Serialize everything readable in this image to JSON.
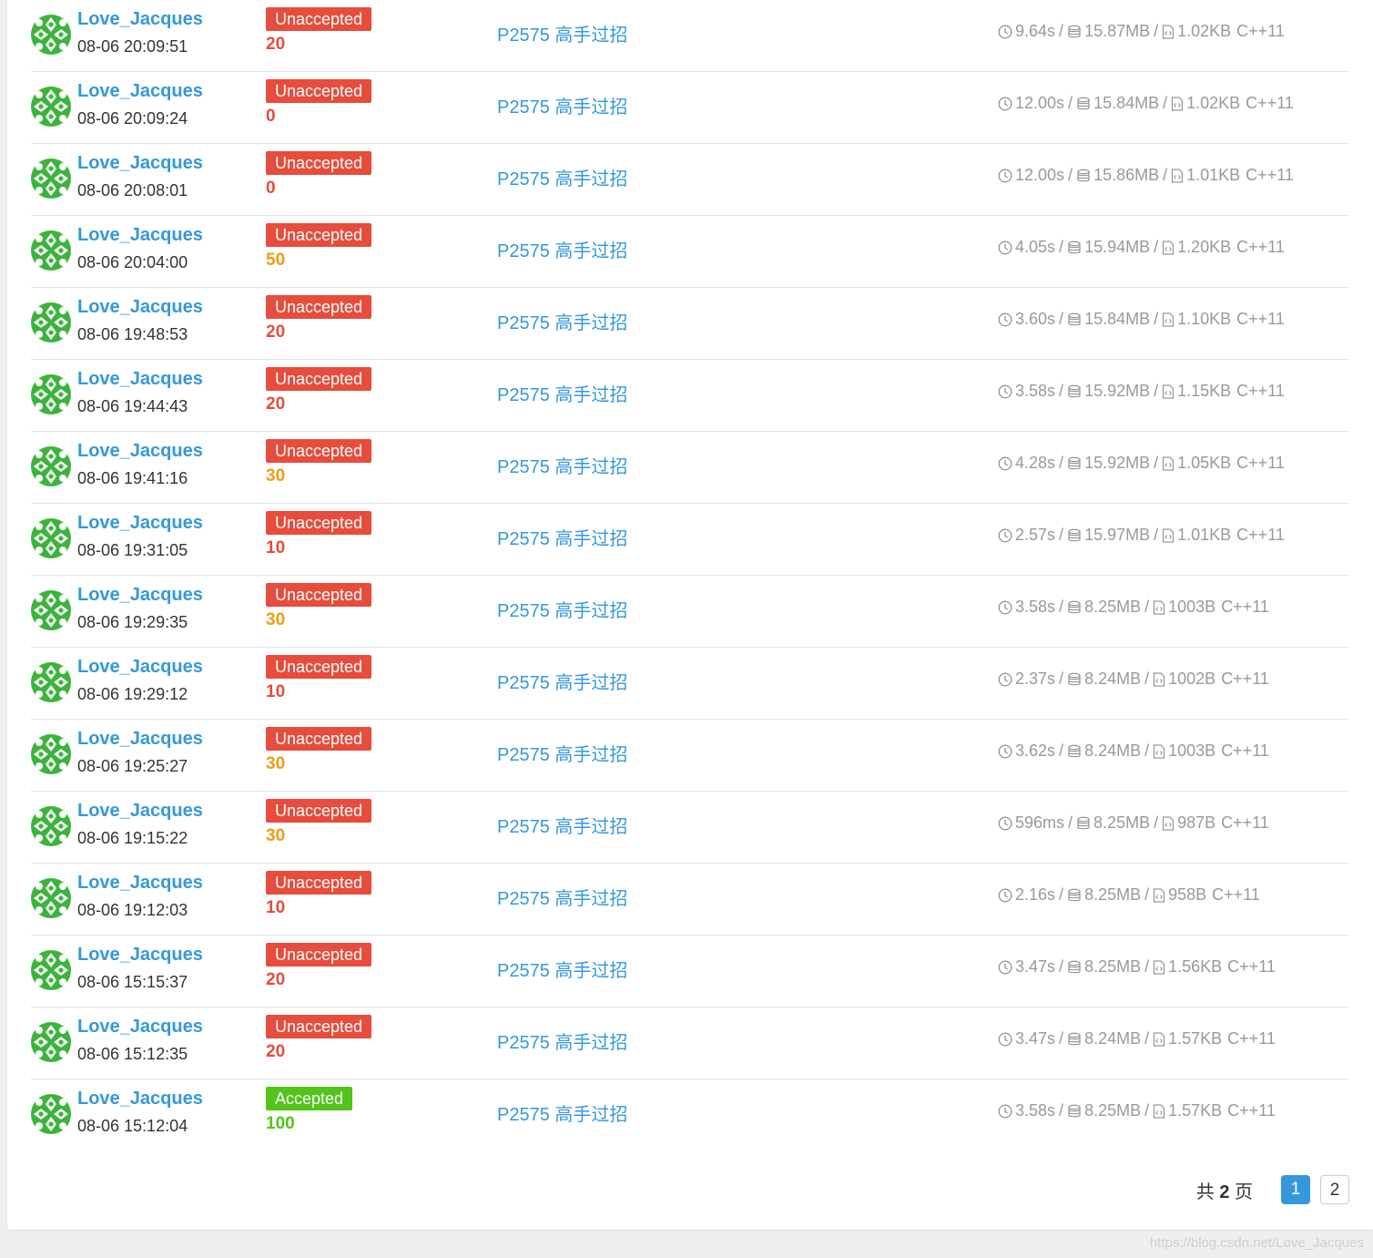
{
  "colors": {
    "link": "#3498db",
    "unaccepted": "#e74c3c",
    "accepted": "#52c41a",
    "score_low": "#e74c3c",
    "score_mid": "#f39c12",
    "score_full": "#52c41a"
  },
  "records": [
    {
      "user": "Love_Jacques",
      "time": "08-06 20:09:51",
      "status": "Unaccepted",
      "score": "20",
      "problem": "P2575 高手过招",
      "runtime": "9.64s",
      "memory": "15.87MB",
      "code_size": "1.02KB",
      "lang": "C++11"
    },
    {
      "user": "Love_Jacques",
      "time": "08-06 20:09:24",
      "status": "Unaccepted",
      "score": "0",
      "problem": "P2575 高手过招",
      "runtime": "12.00s",
      "memory": "15.84MB",
      "code_size": "1.02KB",
      "lang": "C++11"
    },
    {
      "user": "Love_Jacques",
      "time": "08-06 20:08:01",
      "status": "Unaccepted",
      "score": "0",
      "problem": "P2575 高手过招",
      "runtime": "12.00s",
      "memory": "15.86MB",
      "code_size": "1.01KB",
      "lang": "C++11"
    },
    {
      "user": "Love_Jacques",
      "time": "08-06 20:04:00",
      "status": "Unaccepted",
      "score": "50",
      "problem": "P2575 高手过招",
      "runtime": "4.05s",
      "memory": "15.94MB",
      "code_size": "1.20KB",
      "lang": "C++11"
    },
    {
      "user": "Love_Jacques",
      "time": "08-06 19:48:53",
      "status": "Unaccepted",
      "score": "20",
      "problem": "P2575 高手过招",
      "runtime": "3.60s",
      "memory": "15.84MB",
      "code_size": "1.10KB",
      "lang": "C++11"
    },
    {
      "user": "Love_Jacques",
      "time": "08-06 19:44:43",
      "status": "Unaccepted",
      "score": "20",
      "problem": "P2575 高手过招",
      "runtime": "3.58s",
      "memory": "15.92MB",
      "code_size": "1.15KB",
      "lang": "C++11"
    },
    {
      "user": "Love_Jacques",
      "time": "08-06 19:41:16",
      "status": "Unaccepted",
      "score": "30",
      "problem": "P2575 高手过招",
      "runtime": "4.28s",
      "memory": "15.92MB",
      "code_size": "1.05KB",
      "lang": "C++11"
    },
    {
      "user": "Love_Jacques",
      "time": "08-06 19:31:05",
      "status": "Unaccepted",
      "score": "10",
      "problem": "P2575 高手过招",
      "runtime": "2.57s",
      "memory": "15.97MB",
      "code_size": "1.01KB",
      "lang": "C++11"
    },
    {
      "user": "Love_Jacques",
      "time": "08-06 19:29:35",
      "status": "Unaccepted",
      "score": "30",
      "problem": "P2575 高手过招",
      "runtime": "3.58s",
      "memory": "8.25MB",
      "code_size": "1003B",
      "lang": "C++11"
    },
    {
      "user": "Love_Jacques",
      "time": "08-06 19:29:12",
      "status": "Unaccepted",
      "score": "10",
      "problem": "P2575 高手过招",
      "runtime": "2.37s",
      "memory": "8.24MB",
      "code_size": "1002B",
      "lang": "C++11"
    },
    {
      "user": "Love_Jacques",
      "time": "08-06 19:25:27",
      "status": "Unaccepted",
      "score": "30",
      "problem": "P2575 高手过招",
      "runtime": "3.62s",
      "memory": "8.24MB",
      "code_size": "1003B",
      "lang": "C++11"
    },
    {
      "user": "Love_Jacques",
      "time": "08-06 19:15:22",
      "status": "Unaccepted",
      "score": "30",
      "problem": "P2575 高手过招",
      "runtime": "596ms",
      "memory": "8.25MB",
      "code_size": "987B",
      "lang": "C++11"
    },
    {
      "user": "Love_Jacques",
      "time": "08-06 19:12:03",
      "status": "Unaccepted",
      "score": "10",
      "problem": "P2575 高手过招",
      "runtime": "2.16s",
      "memory": "8.25MB",
      "code_size": "958B",
      "lang": "C++11"
    },
    {
      "user": "Love_Jacques",
      "time": "08-06 15:15:37",
      "status": "Unaccepted",
      "score": "20",
      "problem": "P2575 高手过招",
      "runtime": "3.47s",
      "memory": "8.25MB",
      "code_size": "1.56KB",
      "lang": "C++11"
    },
    {
      "user": "Love_Jacques",
      "time": "08-06 15:12:35",
      "status": "Unaccepted",
      "score": "20",
      "problem": "P2575 高手过招",
      "runtime": "3.47s",
      "memory": "8.24MB",
      "code_size": "1.57KB",
      "lang": "C++11"
    },
    {
      "user": "Love_Jacques",
      "time": "08-06 15:12:04",
      "status": "Accepted",
      "score": "100",
      "problem": "P2575 高手过招",
      "runtime": "3.58s",
      "memory": "8.25MB",
      "code_size": "1.57KB",
      "lang": "C++11"
    }
  ],
  "pagination": {
    "total_prefix": "共",
    "total_pages": "2",
    "total_suffix": "页",
    "pages": [
      "1",
      "2"
    ],
    "current": "1"
  },
  "watermark": "https://blog.csdn.net/Love_Jacques"
}
